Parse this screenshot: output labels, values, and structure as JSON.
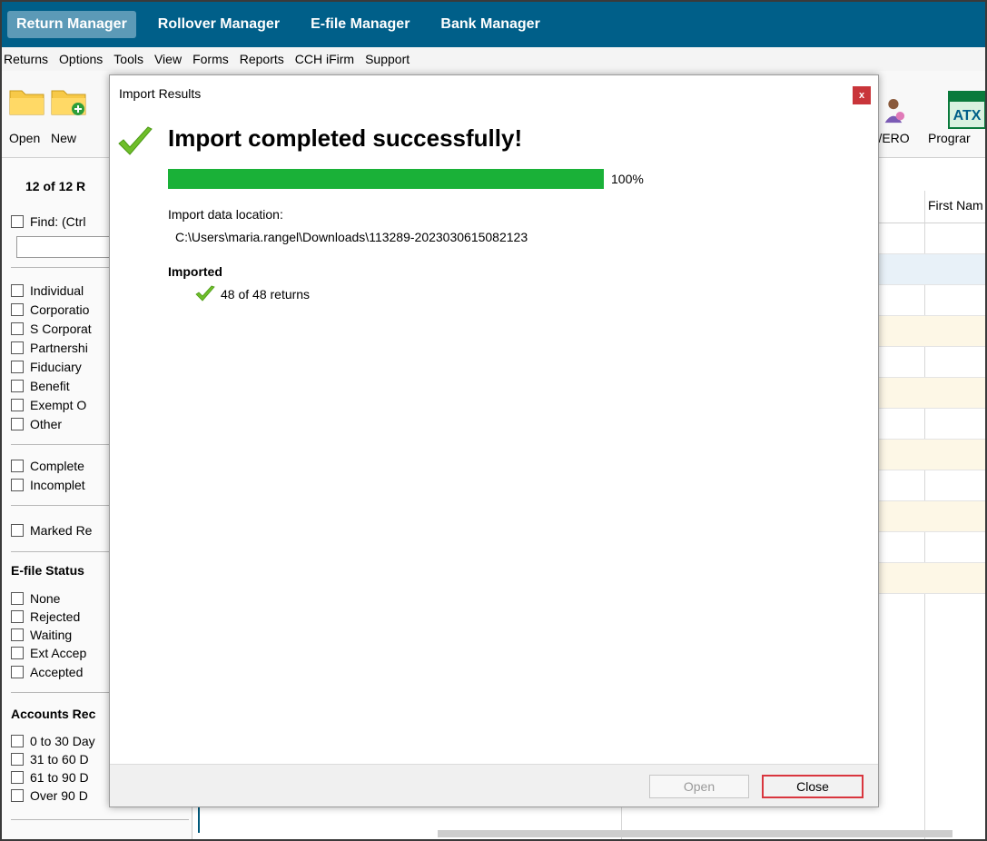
{
  "navbar": {
    "tabs": [
      {
        "label": "Return Manager",
        "active": true
      },
      {
        "label": "Rollover Manager",
        "active": false
      },
      {
        "label": "E-file Manager",
        "active": false
      },
      {
        "label": "Bank Manager",
        "active": false
      }
    ]
  },
  "menubar": {
    "items": [
      "Returns",
      "Options",
      "Tools",
      "View",
      "Forms",
      "Reports",
      "CCH iFirm",
      "Support"
    ]
  },
  "toolbar": {
    "open_label": "Open",
    "new_label": "New",
    "preparer_label": "er/ERO",
    "program_label": "Prograr",
    "atx_text": "ATX"
  },
  "left_panel": {
    "count_title": "12 of 12  R",
    "find_label": "Find: (Ctrl",
    "return_types": [
      "Individual",
      "Corporatio",
      "S Corporat",
      "Partnershi",
      "Fiduciary",
      "Benefit",
      "Exempt O",
      "Other"
    ],
    "completion": [
      "Complete",
      "Incomplet"
    ],
    "marked": "Marked Re",
    "efile_title": "E-file Status",
    "efile_statuses": [
      "None",
      "Rejected",
      "Waiting",
      "Ext Accep",
      "Accepted"
    ],
    "ar_title": "Accounts Rec",
    "ar_ranges": [
      "0 to 30 Day",
      "31 to 60 D",
      "61 to 90 D",
      "Over 90 D"
    ]
  },
  "grid": {
    "first_name_header": "First Nam"
  },
  "modal": {
    "title": "Import Results",
    "close_icon": "x",
    "headline": "Import completed successfully!",
    "progress_percent": 100,
    "progress_label": "100%",
    "location_label": "Import data location:",
    "location_path": "C:\\Users\\maria.rangel\\Downloads\\113289-2023030615082123",
    "imported_heading": "Imported",
    "imported_count": "48 of 48 returns",
    "open_button": "Open",
    "close_button": "Close"
  },
  "colors": {
    "navbar": "#005f89",
    "active_tab": "#5c9ab7",
    "progress": "#1ab138",
    "close_highlight": "#d9363e",
    "check_green": "#6fbe2a"
  }
}
